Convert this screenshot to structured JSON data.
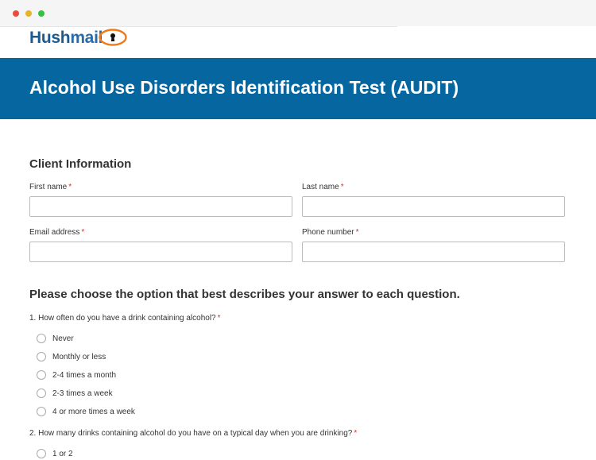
{
  "brand": {
    "name_bold": "Hush",
    "name_light": "mail",
    "accent": "#06669f"
  },
  "banner": {
    "title": "Alcohol Use Disorders Identification Test (AUDIT)"
  },
  "client": {
    "section_title": "Client Information",
    "fields": {
      "first_name": {
        "label": "First name",
        "value": "",
        "required": "*"
      },
      "last_name": {
        "label": "Last name",
        "value": "",
        "required": "*"
      },
      "email": {
        "label": "Email address",
        "value": "",
        "required": "*"
      },
      "phone": {
        "label": "Phone number",
        "value": "",
        "required": "*"
      }
    }
  },
  "questions_heading": "Please choose the option that best describes your answer to each question.",
  "questions": [
    {
      "text": "1. How often do you have a drink containing alcohol?",
      "required": "*",
      "options": [
        "Never",
        "Monthly or less",
        "2-4 times a month",
        "2-3 times a week",
        "4 or more times a week"
      ]
    },
    {
      "text": "2. How many drinks containing alcohol do you have on a typical day when you are drinking?",
      "required": "*",
      "options": [
        "1 or 2"
      ]
    }
  ]
}
